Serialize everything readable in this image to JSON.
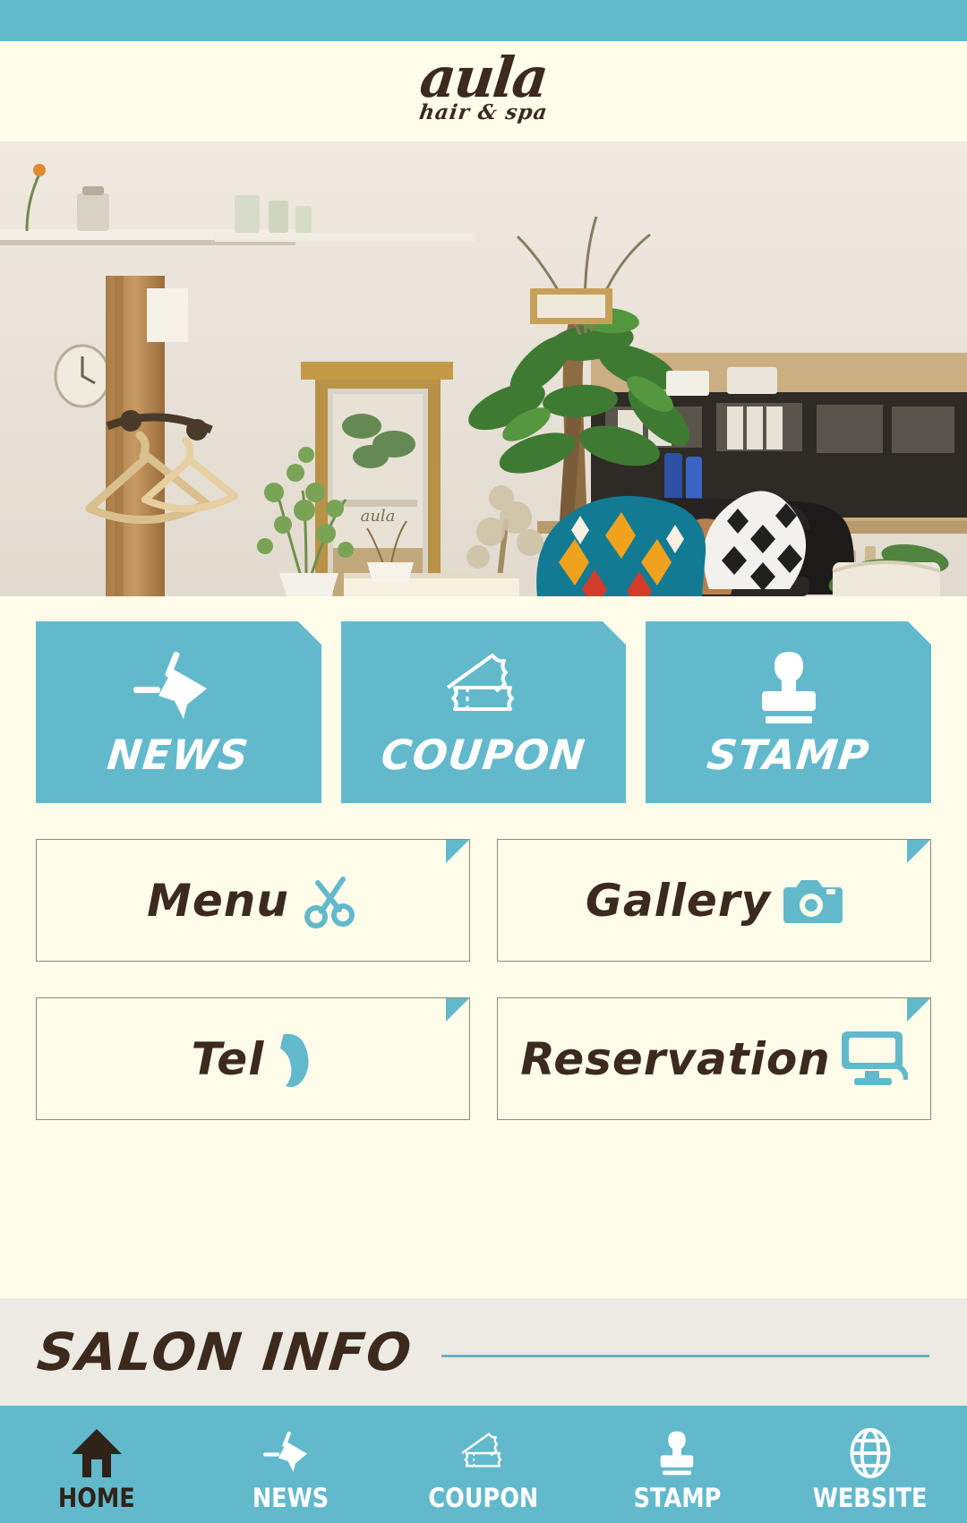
{
  "brand": {
    "logo_text": "aula",
    "logo_tagline": "hair & spa",
    "accent_color": "#63b9cc",
    "background_color": "#fffdea",
    "text_color": "#3b2a1d",
    "info_band_color": "#edeae3"
  },
  "hero": {
    "alt": "salon interior photo with mirror, plants, sofa and coat hangers"
  },
  "tiles": [
    {
      "label": "NEWS",
      "icon": "megaphone-icon"
    },
    {
      "label": "COUPON",
      "icon": "ticket-icon"
    },
    {
      "label": "STAMP",
      "icon": "stamp-icon"
    }
  ],
  "buttons": [
    {
      "label": "Menu",
      "icon": "scissors-icon"
    },
    {
      "label": "Gallery",
      "icon": "camera-icon"
    },
    {
      "label": "Tel",
      "icon": "phone-icon"
    },
    {
      "label": "Reservation",
      "icon": "monitor-icon"
    }
  ],
  "salon_info": {
    "title": "SALON INFO"
  },
  "bottom_nav": [
    {
      "label": "HOME",
      "icon": "home-icon",
      "active": true
    },
    {
      "label": "NEWS",
      "icon": "megaphone-icon",
      "active": false
    },
    {
      "label": "COUPON",
      "icon": "ticket-icon",
      "active": false
    },
    {
      "label": "STAMP",
      "icon": "stamp-icon",
      "active": false
    },
    {
      "label": "WEBSITE",
      "icon": "globe-icon",
      "active": false
    }
  ]
}
